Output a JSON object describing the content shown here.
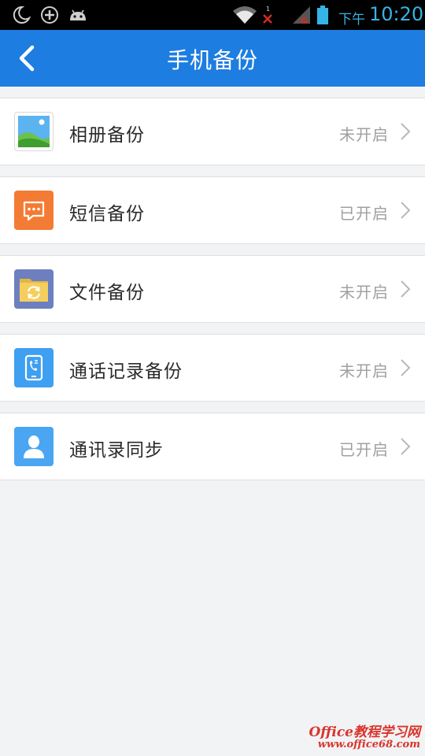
{
  "status_bar": {
    "icons": [
      "moon-icon",
      "add-circle-icon",
      "android-icon",
      "wifi-icon",
      "no-signal-icon",
      "signal-icon",
      "battery-icon"
    ],
    "time_label": "下午",
    "time": "10:20",
    "accent_color": "#33b5e5"
  },
  "header": {
    "title": "手机备份",
    "background_color": "#1d7de0",
    "back_icon": "chevron-left-icon"
  },
  "items": [
    {
      "label": "相册备份",
      "status": "未开启",
      "icon": "photo-album-icon"
    },
    {
      "label": "短信备份",
      "status": "已开启",
      "icon": "sms-icon"
    },
    {
      "label": "文件备份",
      "status": "未开启",
      "icon": "folder-sync-icon"
    },
    {
      "label": "通话记录备份",
      "status": "未开启",
      "icon": "call-log-icon"
    },
    {
      "label": "通讯录同步",
      "status": "已开启",
      "icon": "contacts-icon"
    }
  ],
  "watermark": {
    "line1": "Office教程学习网",
    "line2": "www.office68.com"
  }
}
